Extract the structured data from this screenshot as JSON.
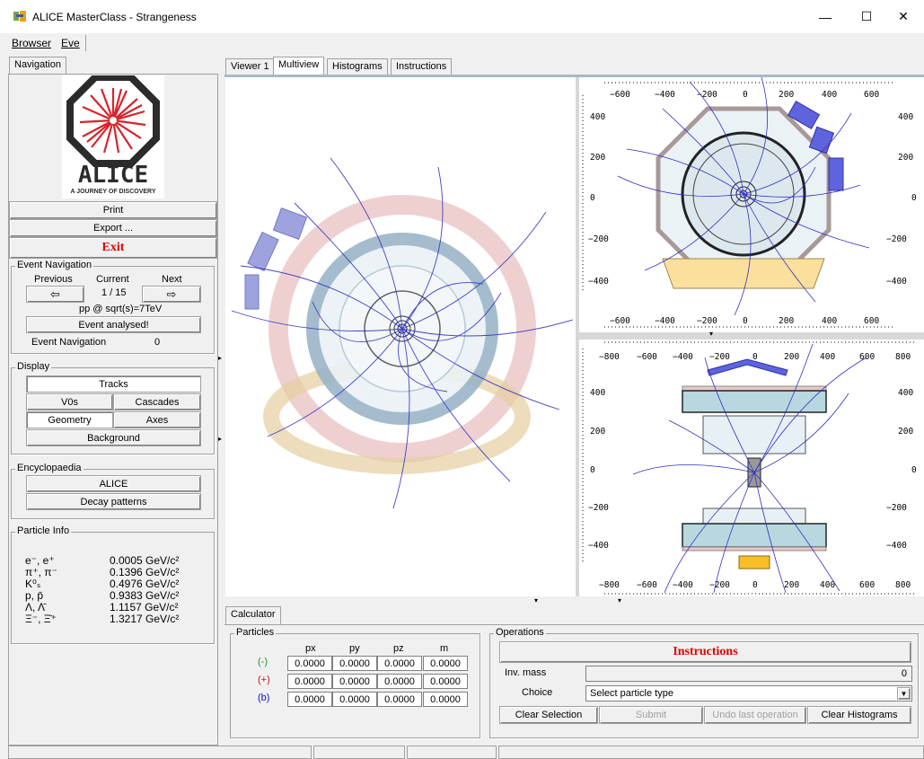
{
  "window": {
    "title": "ALICE MasterClass - Strangeness",
    "minimize": "—",
    "maximize": "☐",
    "close": "✕"
  },
  "menu": {
    "browser": "Browser",
    "eve": "Eve"
  },
  "nav": {
    "tab": "Navigation",
    "logo_text": "ALICE",
    "logo_tagline": "A JOURNEY OF DISCOVERY",
    "print": "Print",
    "export": "Export ...",
    "exit": "Exit"
  },
  "event_nav": {
    "group": "Event Navigation",
    "previous": "Previous",
    "current": "Current",
    "next": "Next",
    "prev_icon": "⇦",
    "next_icon": "⇨",
    "counter": "1 / 15",
    "energy": "pp @ sqrt(s)=7TeV",
    "analysed": "Event analysed!",
    "label": "Event Navigation",
    "value": "0"
  },
  "display": {
    "group": "Display",
    "tracks": "Tracks",
    "v0s": "V0s",
    "cascades": "Cascades",
    "geometry": "Geometry",
    "axes": "Axes",
    "background": "Background"
  },
  "encyclopaedia": {
    "group": "Encyclopaedia",
    "alice": "ALICE",
    "decay": "Decay patterns"
  },
  "particle_info": {
    "group": "Particle Info",
    "rows": [
      {
        "name": "e⁻, e⁺",
        "mass": "0.0005 GeV/c²"
      },
      {
        "name": "π⁺, π⁻",
        "mass": "0.1396 GeV/c²"
      },
      {
        "name": "K⁰ₛ",
        "mass": "0.4976 GeV/c²"
      },
      {
        "name": "p, p̄",
        "mass": "0.9383 GeV/c²"
      },
      {
        "name": "Λ, Λ̄",
        "mass": "1.1157 GeV/c²"
      },
      {
        "name": "Ξ⁻, Ξ̄⁺",
        "mass": "1.3217 GeV/c²"
      }
    ]
  },
  "view_tabs": [
    "Viewer 1",
    "Multiview",
    "Histograms",
    "Instructions"
  ],
  "axes": {
    "top_right_x": [
      "−600",
      "−400",
      "−200",
      "0",
      "200",
      "400",
      "600"
    ],
    "top_right_y": [
      "400",
      "200",
      "0",
      "−200",
      "−400"
    ],
    "bottom_right_x": [
      "−800",
      "−600",
      "−400",
      "−200",
      "0",
      "200",
      "400",
      "600",
      "800"
    ],
    "bottom_right_y": [
      "400",
      "200",
      "0",
      "−200",
      "−400"
    ]
  },
  "calculator": {
    "tab": "Calculator",
    "particles_group": "Particles",
    "headers": [
      "px",
      "py",
      "pz",
      "m"
    ],
    "rows": [
      {
        "label": "(-)",
        "color": "#1a9a1a",
        "values": [
          "0.0000",
          "0.0000",
          "0.0000",
          "0.0000"
        ]
      },
      {
        "label": "(+)",
        "color": "#d01010",
        "values": [
          "0.0000",
          "0.0000",
          "0.0000",
          "0.0000"
        ]
      },
      {
        "label": "(b)",
        "color": "#1010c0",
        "values": [
          "0.0000",
          "0.0000",
          "0.0000",
          "0.0000"
        ]
      }
    ]
  },
  "operations": {
    "group": "Operations",
    "instructions": "Instructions",
    "inv_mass_label": "Inv. mass",
    "inv_mass_value": "0",
    "choice_label": "Choice",
    "choice_value": "Select particle type",
    "clear_selection": "Clear Selection",
    "submit": "Submit",
    "undo": "Undo last operation",
    "clear_histograms": "Clear Histograms"
  },
  "colors": {
    "exit_red": "#e00000",
    "alice_red": "#d8232a",
    "dark": "#2b2b2b"
  }
}
